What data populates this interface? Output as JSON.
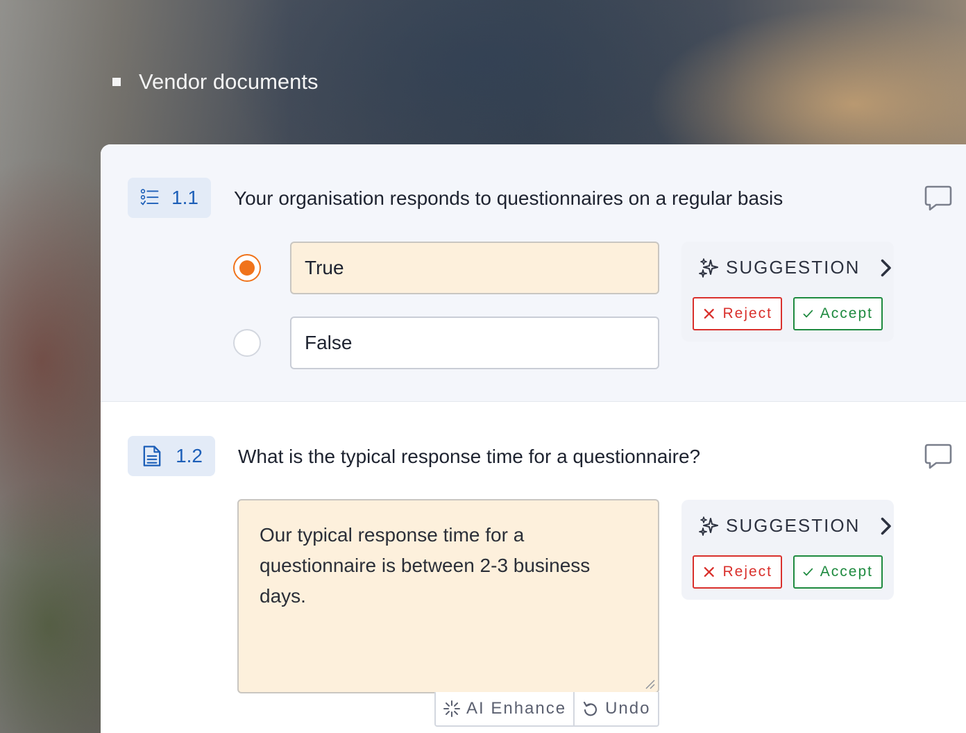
{
  "breadcrumb": {
    "label": "Vendor documents"
  },
  "questions": [
    {
      "number": "1.1",
      "icon": "checklist-icon",
      "text": "Your organisation responds to questionnaires on a regular basis",
      "options": [
        {
          "label": "True",
          "selected": true
        },
        {
          "label": "False",
          "selected": false
        }
      ],
      "suggestion": {
        "title": "SUGGESTION",
        "reject_label": "Reject",
        "accept_label": "Accept"
      }
    },
    {
      "number": "1.2",
      "icon": "document-icon",
      "text": "What is the typical response time for a questionnaire?",
      "answer": "Our typical response time for a questionnaire is between 2-3 business days.",
      "suggestion": {
        "title": "SUGGESTION",
        "reject_label": "Reject",
        "accept_label": "Accept"
      },
      "tools": {
        "enhance_label": "AI Enhance",
        "undo_label": "Undo"
      }
    }
  ],
  "colors": {
    "accent_blue": "#1d5fb8",
    "selected_orange": "#f0731b",
    "reject_red": "#d9302c",
    "accept_green": "#1e8a3f",
    "answer_bg": "#fdf0dc"
  }
}
